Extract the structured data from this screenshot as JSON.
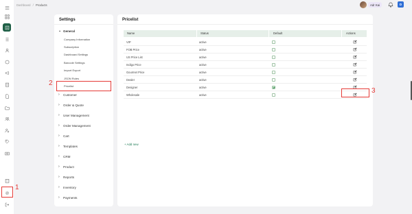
{
  "breadcrumb": {
    "root": "Dashboard",
    "sep": "/",
    "current": "Products"
  },
  "header": {
    "user_name": "Adr Kai",
    "toggle_letter": "D"
  },
  "rail_icons": [
    "grid-icon",
    "apps-icon",
    "products-icon",
    "list-icon",
    "user-icon",
    "box-icon",
    "megaphone-icon",
    "clipboard-icon",
    "document-icon",
    "folder-icon",
    "people-icon",
    "person-gear-icon",
    "tag-icon",
    "camera-icon",
    "building-icon",
    "settings-icon",
    "logout-icon"
  ],
  "settings": {
    "title": "Settings",
    "general_label": "General",
    "general_items": [
      "Company Information",
      "Subscription",
      "Dashboard Settings",
      "Barcode Settings",
      "Import Export",
      "JSON Rules",
      "Pricelist"
    ],
    "sections": [
      "Customer",
      "Order & Quote",
      "User Management",
      "Order Management",
      "Cart",
      "Templates",
      "CRM",
      "Product",
      "Reports",
      "Inventory",
      "Payments"
    ]
  },
  "pricelist": {
    "title": "Pricelist",
    "columns": [
      "Name",
      "Status",
      "Default",
      "Actions"
    ],
    "rows": [
      {
        "name": "VIP",
        "status": "active",
        "default": false
      },
      {
        "name": "FOB Price",
        "status": "active",
        "default": false
      },
      {
        "name": "US Price List",
        "status": "active",
        "default": false
      },
      {
        "name": "Indigo Price",
        "status": "active",
        "default": false
      },
      {
        "name": "Gourmet Price",
        "status": "active",
        "default": false
      },
      {
        "name": "Dealer",
        "status": "active",
        "default": false
      },
      {
        "name": "Designer",
        "status": "active",
        "default": true
      },
      {
        "name": "Wholesale",
        "status": "active",
        "default": false
      }
    ],
    "add_new": "+ Add new"
  },
  "annotations": {
    "n1": "1",
    "n2": "2",
    "n3": "3"
  },
  "colors": {
    "brand": "#1f5f46",
    "highlight": "#e53935",
    "header_bg": "#e6efe9"
  }
}
